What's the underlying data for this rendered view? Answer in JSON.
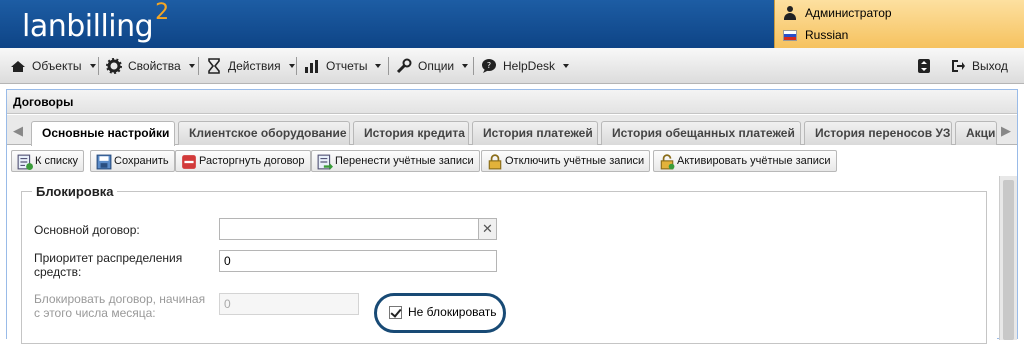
{
  "app": {
    "logo_text": "lanbilling",
    "logo_sup": "2"
  },
  "user": {
    "name": "Администратор",
    "language": "Russian"
  },
  "menu": {
    "items": [
      {
        "label": "Объекты",
        "icon": "objects-icon"
      },
      {
        "label": "Свойства",
        "icon": "gear-icon"
      },
      {
        "label": "Действия",
        "icon": "hourglass-icon"
      },
      {
        "label": "Отчеты",
        "icon": "bar-chart-icon"
      },
      {
        "label": "Опции",
        "icon": "wrench-icon"
      },
      {
        "label": "HelpDesk",
        "icon": "chat-icon"
      }
    ],
    "logout_label": "Выход"
  },
  "panel": {
    "title": "Договоры",
    "tabs": [
      {
        "label": "Основные настройки",
        "active": true
      },
      {
        "label": "Клиентское оборудование",
        "active": false
      },
      {
        "label": "История кредита",
        "active": false
      },
      {
        "label": "История платежей",
        "active": false
      },
      {
        "label": "История обещанных платежей",
        "active": false
      },
      {
        "label": "История переносов УЗ",
        "active": false
      },
      {
        "label": "Акци",
        "active": false
      }
    ]
  },
  "toolbar": {
    "buttons": [
      {
        "label": "К списку",
        "icon": "list-back-icon"
      },
      {
        "label": "Сохранить",
        "icon": "save-icon"
      },
      {
        "label": "Расторгнуть договор",
        "icon": "minus-red-icon"
      },
      {
        "label": "Перенести учётные записи",
        "icon": "transfer-icon"
      },
      {
        "label": "Отключить учётные записи",
        "icon": "lock-icon"
      },
      {
        "label": "Активировать учётные записи",
        "icon": "unlock-icon"
      }
    ]
  },
  "form": {
    "section_title": "Блокировка",
    "main_contract_label": "Основной договор:",
    "main_contract_value": "",
    "priority_label_1": "Приоритет распределения",
    "priority_label_2": "средств:",
    "priority_value": "0",
    "block_label_1": "Блокировать договор, начиная",
    "block_label_2": "с этого числа месяца:",
    "block_value": "0",
    "no_block_label": "Не блокировать",
    "no_block_checked": true
  },
  "colors": {
    "header_blue": "#1d5da4",
    "highlight": "#184a75",
    "user_box": "#f6c25f"
  }
}
